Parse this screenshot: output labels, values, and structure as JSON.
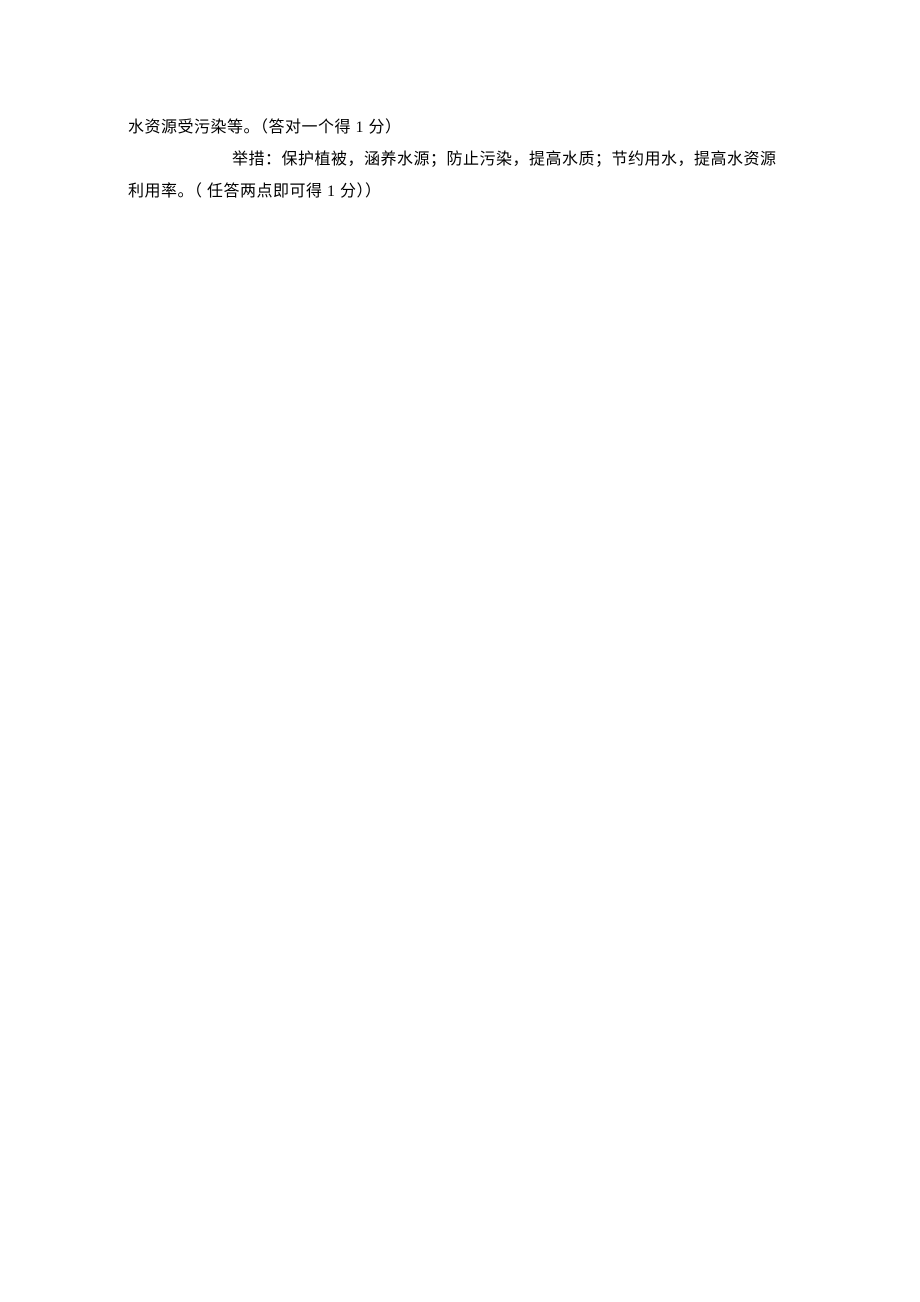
{
  "document": {
    "line1": "水资源受污染等。（答对一个得 1 分）",
    "line2": "举措：保护植被，涵养水源；防止污染，提高水质；节约用水，提高水资源",
    "line3": "利用率。（ 任答两点即可得 1 分））"
  }
}
